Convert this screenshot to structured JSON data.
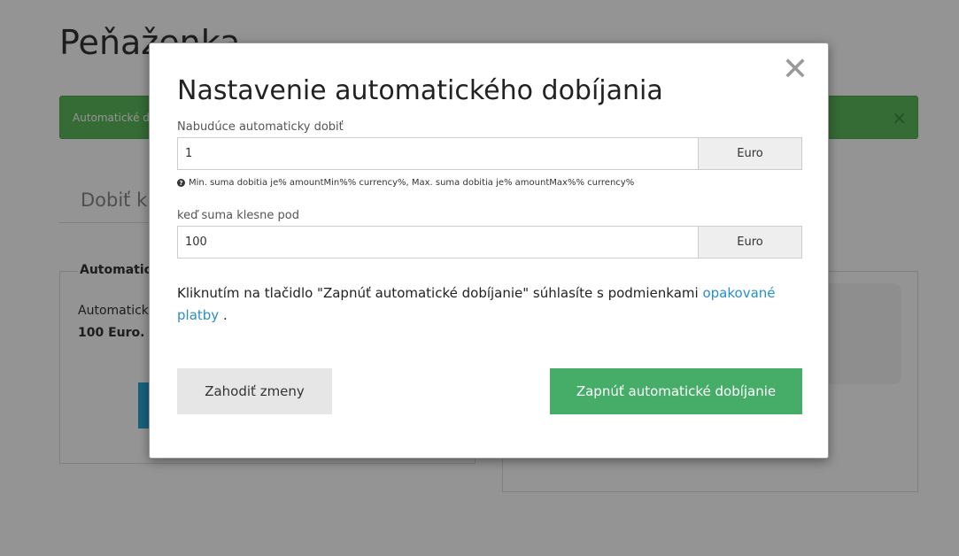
{
  "page": {
    "title": "Peňaženka",
    "alert_text": "Automatické d",
    "alert_close": "×",
    "tab_label": "Dobiť kr",
    "left_panel": {
      "title": "Automatick",
      "text_line1": "Automatick",
      "text_line2": "100 Euro."
    }
  },
  "modal": {
    "title": "Nastavenie automatického dobíjania",
    "close_symbol": "✕",
    "amount_field": {
      "label": "Nabudúce automaticky dobiť",
      "value": "1",
      "currency": "Euro"
    },
    "help_icon": "?",
    "help_text": "Min. suma dobitia je% amountMin%% currency%, Max. suma dobitia je% amountMax%% currency%",
    "threshold_field": {
      "label": "keď suma klesne pod",
      "value": "100",
      "currency": "Euro"
    },
    "terms_text": "Kliknutím na tlačidlo \"Zapnúť automatické dobíjanie\" súhlasíte s podmienkami ",
    "terms_link": "opakované platby",
    "terms_end": " .",
    "discard_button": "Zahodiť zmeny",
    "enable_button": "Zapnúť automatické dobíjanie"
  },
  "colors": {
    "primary_green": "#45ad68",
    "link_blue": "#2a8fc7",
    "alert_green": "#5cb85c"
  }
}
